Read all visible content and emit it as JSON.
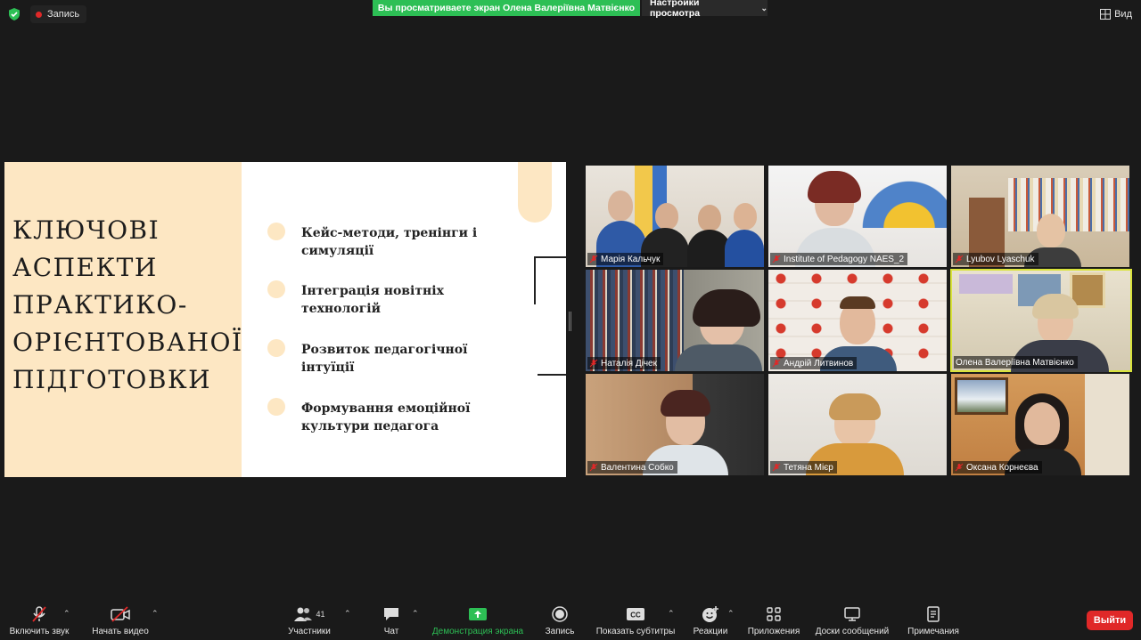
{
  "topbar": {
    "record_label": "Запись",
    "viewing_banner": "Вы просматриваете экран Олена Валеріївна Матвієнко",
    "view_settings_label": "Настройки просмотра",
    "view_label": "Вид"
  },
  "slide": {
    "title_lines": [
      "КЛЮЧОВІ",
      "АСПЕКТИ",
      "ПРАКТИКО-",
      "ОРІЄНТОВАНОЇ",
      "ПІДГОТОВКИ"
    ],
    "items": [
      "Кейс-методи, тренінги і симуляції",
      "Інтеграція новітніх технологій",
      "Розвиток педагогічної інтуїції",
      "Формування емоційної культури педагога"
    ]
  },
  "participants": [
    {
      "name": "Марія Кальчук"
    },
    {
      "name": "Institute of Pedagogy NAES_2"
    },
    {
      "name": "Lyubov Lyaschuk"
    },
    {
      "name": "Наталія Дічек"
    },
    {
      "name": "Андрій Литвинов"
    },
    {
      "name": "Олена Валеріївна Матвієнко"
    },
    {
      "name": "Валентина Собко"
    },
    {
      "name": "Тетяна Мієр"
    },
    {
      "name": "Оксана Корнеєва"
    }
  ],
  "toolbar": {
    "unmute_label": "Включить звук",
    "start_video_label": "Начать видео",
    "participants_label": "Участники",
    "participants_count": "41",
    "chat_label": "Чат",
    "share_label": "Демонстрация экрана",
    "record_label": "Запись",
    "captions_label": "Показать субтитры",
    "reactions_label": "Реакции",
    "apps_label": "Приложения",
    "whiteboards_label": "Доски сообщений",
    "notes_label": "Примечания",
    "leave_label": "Выйти"
  },
  "colors": {
    "accent_green": "#2dbf55",
    "leave_red": "#e02828",
    "slide_beige": "#fde7c3",
    "active_speaker": "#d9e33a"
  }
}
